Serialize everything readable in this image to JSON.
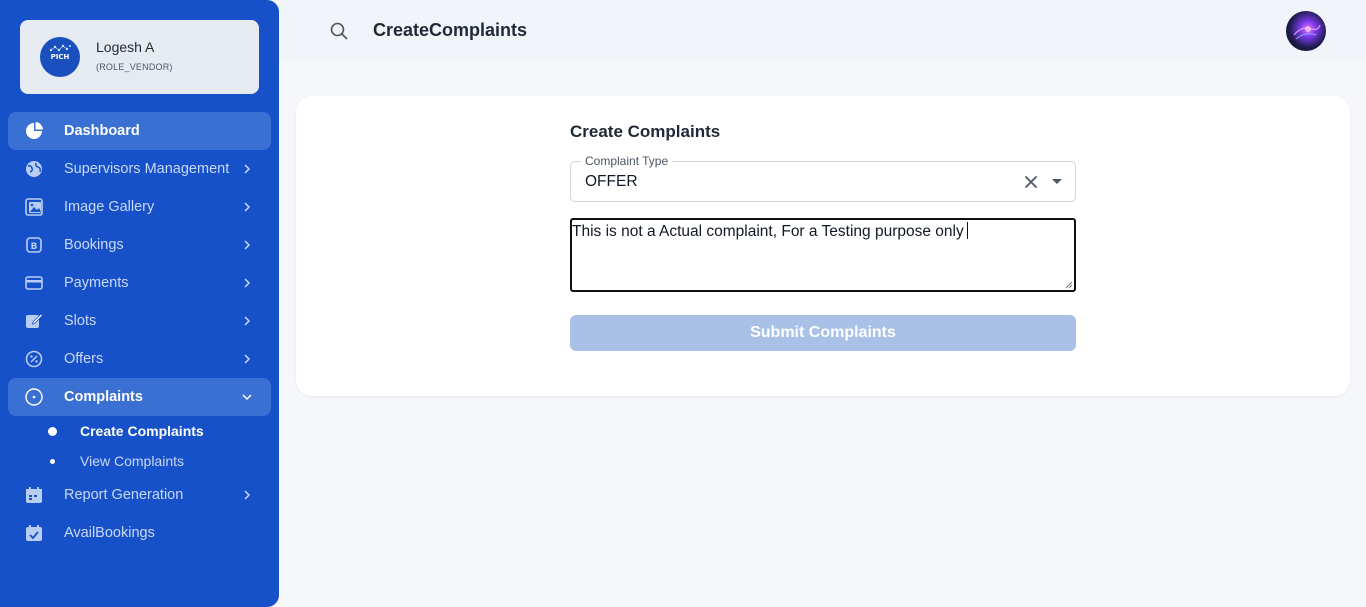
{
  "profile": {
    "name": "Logesh A",
    "role": "(ROLE_VENDOR)",
    "logo_text": "PICH"
  },
  "sidebar": {
    "items": [
      {
        "label": "Dashboard",
        "icon": "pie-chart-icon"
      },
      {
        "label": "Supervisors Management",
        "icon": "globe-icon"
      },
      {
        "label": "Image Gallery",
        "icon": "image-gallery-icon"
      },
      {
        "label": "Bookings",
        "icon": "bookings-icon"
      },
      {
        "label": "Payments",
        "icon": "credit-card-icon"
      },
      {
        "label": "Slots",
        "icon": "edit-square-icon"
      },
      {
        "label": "Offers",
        "icon": "discount-badge-icon"
      },
      {
        "label": "Complaints",
        "icon": "circle-dot-icon"
      },
      {
        "label": "Report Generation",
        "icon": "calendar-icon"
      },
      {
        "label": "AvailBookings",
        "icon": "calendar-check-icon"
      }
    ],
    "sub_items": [
      {
        "label": "Create Complaints"
      },
      {
        "label": "View Complaints"
      }
    ]
  },
  "header": {
    "title": "CreateComplaints"
  },
  "form": {
    "title": "Create Complaints",
    "complaint_type_label": "Complaint Type",
    "complaint_type_value": "OFFER",
    "description": "This is not a Actual complaint, For a Testing purpose only",
    "submit_label": "Submit Complaints"
  },
  "colors": {
    "sidebar_bg": "#1751c9",
    "active_item_bg": "#3a6fd4",
    "submit_btn_bg": "#a9c1e7",
    "page_bg": "#f5f7fa"
  }
}
